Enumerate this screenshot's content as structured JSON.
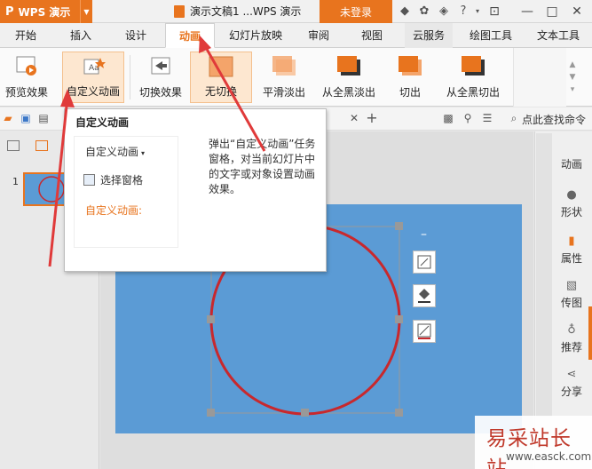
{
  "app": {
    "name": "WPS 演示",
    "logo": "P"
  },
  "document": {
    "title": "演示文稿1 ...WPS 演示"
  },
  "titlebar": {
    "login_label": "未登录",
    "icons": [
      "shirt-icon",
      "gear-icon",
      "share-icon",
      "help-icon"
    ]
  },
  "menu": {
    "tabs": [
      {
        "label": "开始"
      },
      {
        "label": "插入"
      },
      {
        "label": "设计"
      },
      {
        "label": "动画"
      },
      {
        "label": "幻灯片放映"
      },
      {
        "label": "审阅"
      },
      {
        "label": "视图"
      },
      {
        "label": "云服务"
      },
      {
        "label": "绘图工具"
      },
      {
        "label": "文本工具"
      }
    ],
    "active": "动画"
  },
  "ribbon": {
    "preview": "预览效果",
    "custom_anim": "自定义动画",
    "switch_effect": "切换效果",
    "none_switch": "无切换",
    "smooth_fade": "平滑淡出",
    "black_fade": "从全黑淡出",
    "cut": "切出",
    "black_cut": "从全黑切出"
  },
  "qbar": {
    "search_label": "点此查找命令"
  },
  "popup": {
    "title": "自定义动画",
    "dropdown_label": "自定义动画",
    "select_pane": "选择窗格",
    "custom_anim_label": "自定义动画:",
    "description": "弹出“自定义动画”任务窗格，对当前幻灯片中的文字或对象设置动画效果。"
  },
  "slides": {
    "index": "1"
  },
  "right_panel": {
    "items": [
      {
        "label": "动画"
      },
      {
        "label": "形状"
      },
      {
        "label": "属性"
      },
      {
        "label": "传图"
      },
      {
        "label": "推荐"
      },
      {
        "label": "分享"
      }
    ]
  },
  "watermark": {
    "big": "易采站长站",
    "small": "www.easck.com"
  },
  "colors": {
    "accent": "#e8741e",
    "slide": "#5b9bd5",
    "circle": "#c8282d",
    "arrow": "#e03a3a"
  }
}
